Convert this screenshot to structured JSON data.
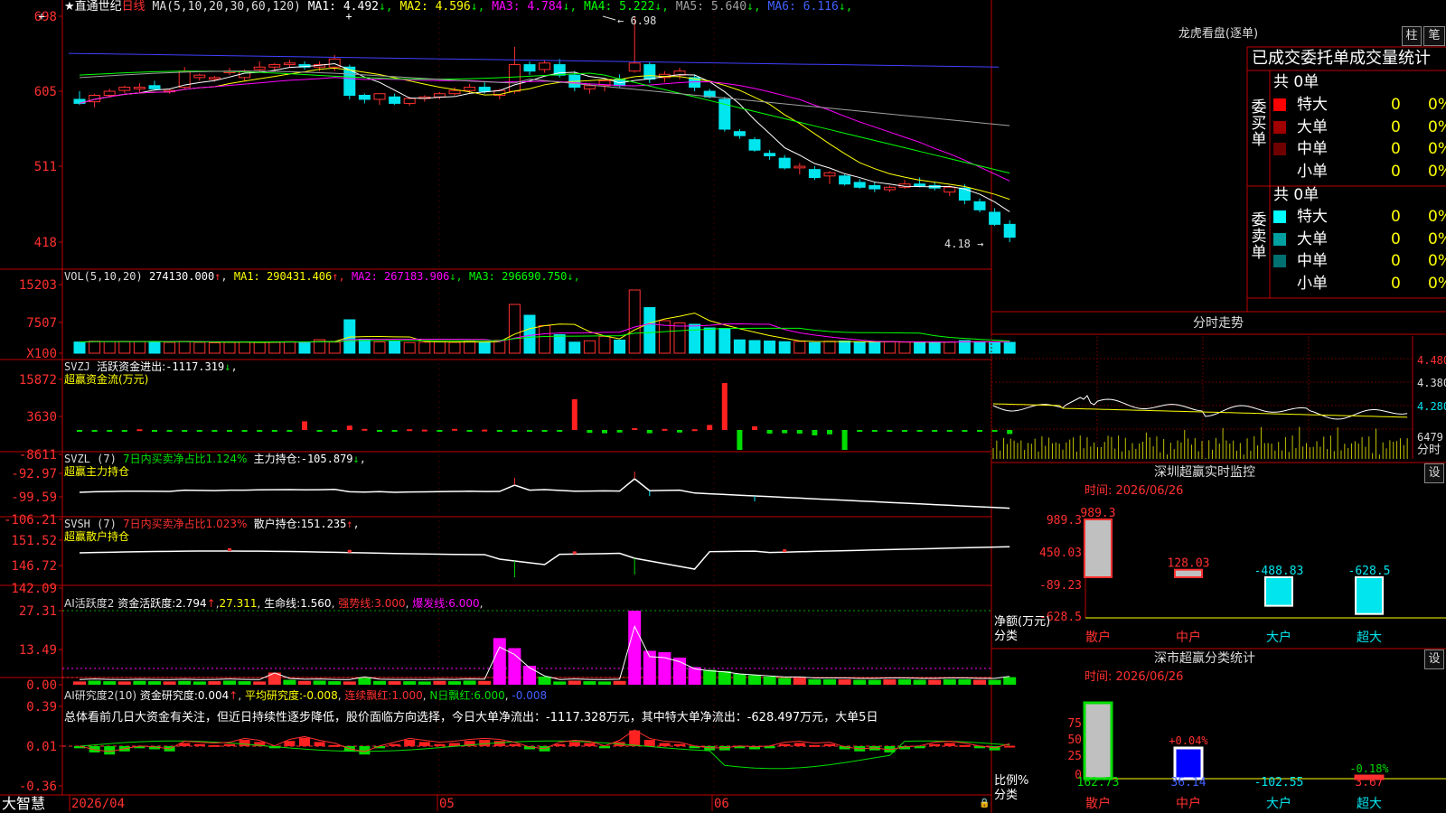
{
  "colors": {
    "up": "#ff3030",
    "down": "#00e5ee",
    "ma1": "#ffffff",
    "ma2": "#ffff00",
    "ma3": "#ff00ff",
    "ma4": "#00ff00",
    "ma5": "#a0a0a0",
    "ma6": "#4040ff",
    "flow_up": "#ff2020",
    "flow_dn": "#00dd00",
    "grid": "#c00000"
  },
  "app": {
    "name": "大智慧",
    "lock": "🔒"
  },
  "kline": {
    "title": "★直通世纪",
    "period": "日线",
    "ma_header": "MA(5,10,20,30,60,120)",
    "ma": [
      {
        "label": "MA1:",
        "value": "4.492",
        "arrow": "↓"
      },
      {
        "label": "MA2:",
        "value": "4.596",
        "arrow": "↓"
      },
      {
        "label": "MA3:",
        "value": "4.784",
        "arrow": "↓"
      },
      {
        "label": "MA4:",
        "value": "5.222",
        "arrow": "↓"
      },
      {
        "label": "MA5:",
        "value": "5.640",
        "arrow": "↓"
      },
      {
        "label": "MA6:",
        "value": "6.116",
        "arrow": "↓"
      }
    ],
    "y_ticks": [
      "698",
      "605",
      "511",
      "418"
    ],
    "high_label": "6.98",
    "low_label": "4.18"
  },
  "vol": {
    "header": "VOL(5,10,20)",
    "value": "274130.000",
    "ma": [
      {
        "label": "MA1:",
        "value": "290431.406",
        "arrow": "↑"
      },
      {
        "label": "MA2:",
        "value": "267183.906",
        "arrow": "↓"
      },
      {
        "label": "MA3:",
        "value": "296690.750",
        "arrow": "↓"
      }
    ],
    "y_ticks": [
      "15203",
      "7507",
      "X100"
    ]
  },
  "svzj": {
    "header": "SVZJ",
    "label": "活跃资金进出:",
    "value": "-1117.319",
    "arrow": "↓",
    "sub": "超赢资金流(万元)",
    "y_ticks": [
      "15872",
      "3630",
      "-8611"
    ]
  },
  "svzl": {
    "header": "SVZL (7)",
    "label": "7日内买卖净占比1.124%",
    "label2": "主力持仓:",
    "value": "-105.879",
    "arrow": "↓",
    "sub": "超赢主力持仓",
    "y_ticks": [
      "-92.97",
      "-99.59",
      "-106.21"
    ]
  },
  "svsh": {
    "header": "SVSH (7)",
    "label": "7日内买卖净占比1.023%",
    "label2": "散户持仓:",
    "value": "151.235",
    "arrow": "↑",
    "sub": "超赢散户持仓",
    "y_ticks": [
      "151.52",
      "146.72",
      "142.09"
    ]
  },
  "ai1": {
    "header": "AI活跃度2",
    "label": "资金活跃度:",
    "value": "2.794",
    "arrow": "↑",
    "v2": "27.311",
    "label3": "生命线:",
    "v3": "1.560",
    "label4": "强势线:",
    "v4": "3.000",
    "label5": "爆发线:",
    "v5": "6.000",
    "y_ticks": [
      "27.31",
      "13.49",
      "0.00"
    ]
  },
  "ai2": {
    "header": "AI研究度2(10)",
    "label": "资金研究度:",
    "value": "0.004",
    "arrow": "↑",
    "label2": "平均研究度:",
    "v2": "-0.008",
    "label3": "连续飘红:",
    "v3": "1.000",
    "label4": "N日飘红:",
    "v4": "6.000",
    "v5": "-0.008",
    "summary": "总体看前几日大资金有关注，但近日持续性逐步降低，股价面临方向选择，今日大单净流出：-1117.328万元，其中特大单净流出：-628.497万元，大单5日",
    "y_ticks": [
      "0.39",
      "0.01",
      "-0.36"
    ]
  },
  "x_axis": [
    "2026/04",
    "05",
    "06"
  ],
  "lhb": {
    "title": "龙虎看盘(逐单)",
    "btn1": "柱",
    "btn2": "笔",
    "header": "已成交委托单成交量统计",
    "buy_label": "委买单",
    "sell_label": "委卖单",
    "buy_total": "共 0单",
    "sell_total": "共 0单",
    "buy": [
      {
        "name": "特大",
        "n": "0",
        "p": "0%",
        "c": "#ff0000"
      },
      {
        "name": "大单",
        "n": "0",
        "p": "0%",
        "c": "#a00000"
      },
      {
        "name": "中单",
        "n": "0",
        "p": "0%",
        "c": "#700000"
      },
      {
        "name": "小单",
        "n": "0",
        "p": "0%",
        "c": "#000000"
      }
    ],
    "sell": [
      {
        "name": "特大",
        "n": "0",
        "p": "0%",
        "c": "#00ffff"
      },
      {
        "name": "大单",
        "n": "0",
        "p": "0%",
        "c": "#00a0a0"
      },
      {
        "name": "中单",
        "n": "0",
        "p": "0%",
        "c": "#007070"
      },
      {
        "name": "小单",
        "n": "0",
        "p": "0%",
        "c": "#000000"
      }
    ]
  },
  "intraday": {
    "title": "分时走势",
    "prices": [
      "4.480",
      "4.380",
      "4.280"
    ],
    "vol": "6479",
    "vol_unit": "分时"
  },
  "monitor": {
    "title": "深圳超赢实时监控",
    "btn": "设",
    "time": "时间: 2026/06/26",
    "y_ticks": [
      "989.3",
      "450.03",
      "-89.23",
      "-628.5"
    ],
    "unit": "净额(万元)",
    "axis_label": "分类",
    "cats": [
      "散户",
      "中户",
      "大户",
      "超大"
    ],
    "values": [
      "989.3",
      "128.03",
      "-488.83",
      "-628.5"
    ]
  },
  "stats": {
    "title": "深市超赢分类统计",
    "btn": "设",
    "time": "时间: 2026/06/26",
    "y_ticks": [
      "75",
      "50",
      "25",
      "0"
    ],
    "unit": "比例%",
    "axis_label": "分类",
    "cats": [
      "散户",
      "中户",
      "大户",
      "超大"
    ],
    "bottom": [
      "162.73",
      "36.14",
      "-102.55",
      "3.67"
    ],
    "tops": [
      "",
      "+0.04%",
      "",
      "-0.18%"
    ]
  },
  "chart_data": [
    {
      "type": "candlestick",
      "title": "直通世纪 日线",
      "x": [
        "2026/04",
        "05",
        "06"
      ],
      "ylim": [
        4.18,
        6.98
      ],
      "ma": {
        "MA1": 4.492,
        "MA2": 4.596,
        "MA3": 4.784,
        "MA4": 5.222,
        "MA5": 5.64,
        "MA6": 6.116
      },
      "ohlc": [
        [
          5.95,
          6.05,
          5.88,
          5.9
        ],
        [
          5.92,
          6.02,
          5.85,
          6.0
        ],
        [
          6.0,
          6.08,
          5.97,
          6.05
        ],
        [
          6.06,
          6.12,
          6.03,
          6.1
        ],
        [
          6.08,
          6.15,
          6.04,
          6.1
        ],
        [
          6.12,
          6.18,
          6.06,
          6.08
        ],
        [
          6.05,
          6.08,
          6.02,
          6.06
        ],
        [
          6.1,
          6.35,
          6.08,
          6.3
        ],
        [
          6.22,
          6.27,
          6.18,
          6.25
        ],
        [
          6.2,
          6.24,
          6.17,
          6.22
        ],
        [
          6.28,
          6.34,
          6.25,
          6.3
        ],
        [
          6.22,
          6.32,
          6.18,
          6.3
        ],
        [
          6.32,
          6.42,
          6.28,
          6.35
        ],
        [
          6.35,
          6.4,
          6.3,
          6.38
        ],
        [
          6.38,
          6.44,
          6.34,
          6.4
        ],
        [
          6.38,
          6.42,
          6.32,
          6.35
        ],
        [
          6.35,
          6.42,
          6.3,
          6.38
        ],
        [
          6.35,
          6.5,
          6.3,
          6.45
        ],
        [
          6.35,
          6.38,
          5.95,
          6.0
        ],
        [
          6.0,
          6.02,
          5.9,
          5.95
        ],
        [
          5.95,
          6.02,
          5.88,
          6.02
        ],
        [
          5.98,
          6.02,
          5.88,
          5.9
        ],
        [
          5.9,
          5.98,
          5.87,
          5.96
        ],
        [
          5.96,
          6.0,
          5.92,
          5.98
        ],
        [
          5.98,
          6.04,
          5.95,
          6.02
        ],
        [
          6.02,
          6.1,
          6.0,
          6.06
        ],
        [
          6.06,
          6.14,
          6.02,
          6.1
        ],
        [
          6.1,
          6.16,
          6.02,
          6.05
        ],
        [
          6.0,
          6.08,
          5.95,
          6.06
        ],
        [
          6.05,
          6.6,
          6.02,
          6.38
        ],
        [
          6.38,
          6.42,
          6.25,
          6.3
        ],
        [
          6.32,
          6.44,
          6.28,
          6.4
        ],
        [
          6.38,
          6.45,
          6.22,
          6.25
        ],
        [
          6.25,
          6.3,
          6.05,
          6.1
        ],
        [
          6.08,
          6.15,
          6.02,
          6.12
        ],
        [
          6.12,
          6.2,
          6.05,
          6.18
        ],
        [
          6.2,
          6.26,
          6.1,
          6.12
        ],
        [
          6.3,
          6.98,
          6.28,
          6.4
        ],
        [
          6.38,
          6.42,
          6.15,
          6.2
        ],
        [
          6.22,
          6.3,
          6.16,
          6.26
        ],
        [
          6.25,
          6.34,
          6.2,
          6.3
        ],
        [
          6.22,
          6.26,
          6.05,
          6.1
        ],
        [
          6.05,
          6.08,
          5.96,
          5.98
        ],
        [
          5.95,
          5.98,
          5.55,
          5.58
        ],
        [
          5.55,
          5.58,
          5.46,
          5.5
        ],
        [
          5.45,
          5.48,
          5.3,
          5.32
        ],
        [
          5.28,
          5.32,
          5.2,
          5.25
        ],
        [
          5.22,
          5.26,
          5.08,
          5.1
        ],
        [
          5.1,
          5.16,
          5.02,
          5.12
        ],
        [
          5.08,
          5.12,
          4.95,
          4.98
        ],
        [
          5.0,
          5.06,
          4.9,
          5.04
        ],
        [
          5.0,
          5.02,
          4.88,
          4.9
        ],
        [
          4.92,
          4.96,
          4.84,
          4.86
        ],
        [
          4.88,
          4.92,
          4.8,
          4.84
        ],
        [
          4.83,
          4.88,
          4.8,
          4.86
        ],
        [
          4.86,
          4.95,
          4.84,
          4.9
        ],
        [
          4.9,
          4.98,
          4.86,
          4.88
        ],
        [
          4.88,
          4.92,
          4.82,
          4.85
        ],
        [
          4.8,
          4.88,
          4.75,
          4.86
        ],
        [
          4.85,
          4.9,
          4.65,
          4.7
        ],
        [
          4.68,
          4.72,
          4.55,
          4.58
        ],
        [
          4.55,
          4.6,
          4.38,
          4.4
        ],
        [
          4.4,
          4.45,
          4.18,
          4.24
        ]
      ]
    },
    {
      "type": "bar",
      "title": "VOL(5,10,20)",
      "ylim": [
        0,
        15203
      ],
      "values": [
        2480,
        2650,
        2600,
        2620,
        2580,
        2610,
        2400,
        2620,
        2400,
        2300,
        2450,
        2500,
        2400,
        2420,
        2550,
        2450,
        3000,
        2450,
        7400,
        3100,
        2500,
        2700,
        2350,
        2450,
        2500,
        2400,
        2650,
        2400,
        2850,
        10800,
        8400,
        6100,
        4100,
        2450,
        2750,
        3700,
        2900,
        14000,
        10100,
        7200,
        6700,
        6400,
        5600,
        5500,
        2950,
        2800,
        2700,
        2550,
        2600,
        2350,
        2650,
        2700,
        2450,
        2400,
        2500,
        2450,
        2500,
        2350,
        2480,
        2800,
        2550,
        2500,
        2400
      ]
    },
    {
      "type": "bar",
      "title": "SVZJ 超赢资金流(万元)",
      "ylim": [
        -8611,
        15872
      ],
      "values": [
        -50,
        -100,
        -80,
        -120,
        200,
        -150,
        -100,
        -90,
        -100,
        -120,
        -80,
        -200,
        -300,
        -250,
        -200,
        2400,
        -500,
        -120,
        1200,
        300,
        -120,
        -80,
        200,
        100,
        -100,
        300,
        -150,
        100,
        -120,
        -100,
        -200,
        -150,
        -180,
        8500,
        -800,
        -900,
        -700,
        500,
        -900,
        300,
        -700,
        200,
        1400,
        13000,
        -5500,
        1000,
        -1000,
        -900,
        -1000,
        -1500,
        -1200,
        -5500,
        -200,
        -150,
        -180,
        -200,
        -150,
        -120,
        -200,
        -150,
        -180,
        -200,
        -1117
      ]
    },
    {
      "type": "bar",
      "title": "AI活跃度2",
      "ylim": [
        0,
        27.31
      ],
      "values": [
        1.2,
        1.5,
        1.3,
        1.2,
        1.4,
        1.3,
        1.2,
        1.4,
        1.2,
        1.3,
        1.5,
        1.3,
        1.2,
        4.5,
        1.8,
        1.4,
        1.5,
        1.3,
        1.2,
        2.5,
        1.4,
        1.3,
        1.3,
        1.2,
        1.4,
        1.3,
        1.5,
        1.4,
        17.2,
        13.5,
        7.0,
        3.0,
        1.2,
        1.5,
        1.3,
        1.2,
        1.4,
        27.3,
        12.5,
        12.0,
        10.0,
        6.5,
        5.5,
        5.0,
        4.0,
        3.5,
        3.0,
        2.5,
        2.5,
        2.0,
        2.0,
        2.0,
        1.8,
        1.8,
        2.0,
        2.0,
        1.8,
        1.8,
        2.0,
        2.0,
        1.8,
        1.8,
        2.794
      ]
    },
    {
      "type": "bar",
      "title": "AI研究度2(10)",
      "ylim": [
        -0.36,
        0.39
      ],
      "values": [
        -0.02,
        -0.06,
        -0.08,
        -0.05,
        -0.02,
        -0.03,
        -0.05,
        0.03,
        0.02,
        0.01,
        0.02,
        0.06,
        0.04,
        -0.02,
        0.05,
        0.08,
        0.04,
        0.01,
        -0.05,
        -0.08,
        -0.02,
        0.02,
        0.06,
        0.04,
        0.02,
        0.03,
        0.05,
        0.06,
        0.05,
        0.02,
        -0.03,
        -0.05,
        0.02,
        0.04,
        0.03,
        -0.02,
        0.04,
        0.15,
        0.06,
        0.03,
        0.02,
        -0.02,
        -0.04,
        -0.04,
        -0.02,
        -0.03,
        -0.02,
        0.02,
        0.03,
        0.01,
        0.02,
        -0.03,
        -0.05,
        -0.04,
        -0.06,
        -0.03,
        -0.02,
        0.02,
        0.03,
        0.01,
        -0.02,
        -0.04,
        0.004
      ]
    },
    {
      "type": "bar",
      "title": "深圳超赢实时监控",
      "categories": [
        "散户",
        "中户",
        "大户",
        "超大"
      ],
      "values": [
        989.3,
        128.03,
        -488.83,
        -628.5
      ],
      "ylim": [
        -628.5,
        989.3
      ]
    },
    {
      "type": "bar",
      "title": "深市超赢分类统计",
      "categories": [
        "散户",
        "中户",
        "大户",
        "超大"
      ],
      "values": [
        162.73,
        36.14,
        -102.55,
        3.67
      ]
    }
  ]
}
